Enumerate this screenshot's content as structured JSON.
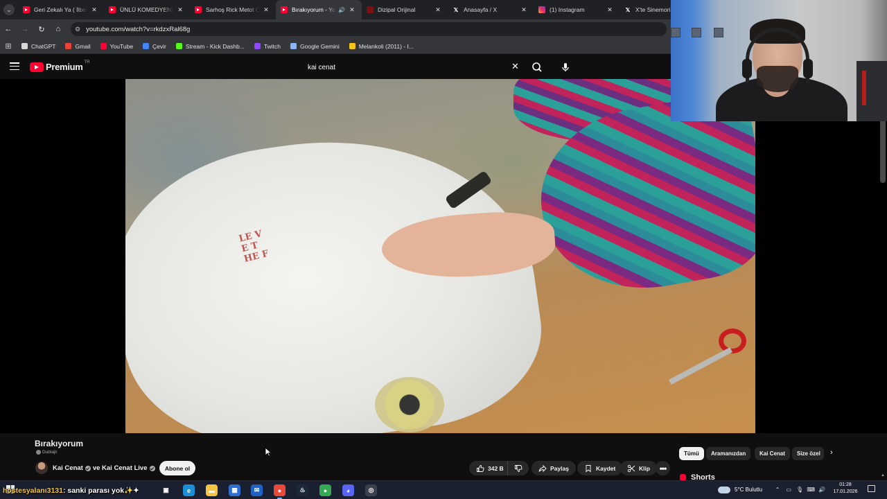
{
  "browser": {
    "tabs": [
      {
        "title": "Geri Zekalı Ya ( İlber O",
        "favicon": "youtube-icon",
        "active": false
      },
      {
        "title": "ÜNLÜ KOMEDYENLER",
        "favicon": "youtube-icon",
        "active": false
      },
      {
        "title": "Sarhoş Rick Metot Oy",
        "favicon": "youtube-icon",
        "active": false
      },
      {
        "title": "Bırakıyorum - You",
        "favicon": "youtube-icon",
        "active": true
      },
      {
        "title": "Dizipal Orijinal",
        "favicon": "dizipal-icon",
        "active": false
      },
      {
        "title": "Anasayfa / X",
        "favicon": "x-icon",
        "active": false
      },
      {
        "title": "(1) Instagram",
        "favicon": "instagram-icon",
        "active": false
      },
      {
        "title": "X'te Sinemori: \"Re",
        "favicon": "x-icon",
        "active": false
      }
    ],
    "url": "youtube.com/watch?v=rkdzxRal68g",
    "bookmarks": [
      {
        "label": "ChatGPT",
        "icon": "chatgpt-icon",
        "color": "#d9d9d9"
      },
      {
        "label": "Gmail",
        "icon": "gmail-icon",
        "color": "#ea4335"
      },
      {
        "label": "YouTube",
        "icon": "youtube-icon",
        "color": "#ff0033"
      },
      {
        "label": "Çevir",
        "icon": "translate-icon",
        "color": "#4285f4"
      },
      {
        "label": "Stream - Kick Dashb...",
        "icon": "kick-icon",
        "color": "#53fc18"
      },
      {
        "label": "Twitch",
        "icon": "twitch-icon",
        "color": "#9146ff"
      },
      {
        "label": "Google Gemini",
        "icon": "gemini-icon",
        "color": "#8ab4f8"
      },
      {
        "label": "Melankoli (2011) - I...",
        "icon": "imdb-icon",
        "color": "#f5c518"
      }
    ]
  },
  "youtube": {
    "logo_text": "Premium",
    "logo_region": "TR",
    "search_query": "kai cenat",
    "video": {
      "title": "Bırakıyorum",
      "dub_label": "Dublajlı",
      "channel": "Kai Cenat",
      "channel_joiner": "ve Kai Cenat Live",
      "subscribe_label": "Abone ol",
      "likes": "342 B",
      "share_label": "Paylaş",
      "save_label": "Kaydet",
      "clip_label": "Klip",
      "print_text": "⁠ゟ",
      "print_lines": "LE V\nE T\nHE F"
    },
    "chips": [
      {
        "label": "Tümü",
        "active": true
      },
      {
        "label": "Aramanızdan",
        "active": false
      },
      {
        "label": "Kai Cenat",
        "active": false
      },
      {
        "label": "Size özel",
        "active": false
      }
    ],
    "shorts_label": "Shorts"
  },
  "stream_overlay": {
    "chat_user": "hostesyalanı3131",
    "chat_message": ": sanki parası yok✨✦"
  },
  "taskbar": {
    "weather": "5°C  Bulutlu",
    "time": "01:28",
    "date": "17.01.2026",
    "apps": [
      {
        "name": "task-view-icon",
        "color": "transparent",
        "glyph": "▣"
      },
      {
        "name": "edge-icon",
        "color": "#1a8fd6",
        "glyph": "e"
      },
      {
        "name": "file-explorer-icon",
        "color": "#f4c542",
        "glyph": "▬"
      },
      {
        "name": "store-icon",
        "color": "#2f6fd4",
        "glyph": "▦"
      },
      {
        "name": "outlook-icon",
        "color": "#1e62c4",
        "glyph": "✉"
      },
      {
        "name": "chrome-icon",
        "color": "#e9483b",
        "glyph": "●"
      },
      {
        "name": "steam-icon",
        "color": "#1b2838",
        "glyph": "♨"
      },
      {
        "name": "chrome-profile-icon",
        "color": "#34a853",
        "glyph": "●"
      },
      {
        "name": "discord-icon",
        "color": "#5865f2",
        "glyph": "◕"
      },
      {
        "name": "obs-icon",
        "color": "#3a3f4b",
        "glyph": "◎"
      }
    ]
  }
}
